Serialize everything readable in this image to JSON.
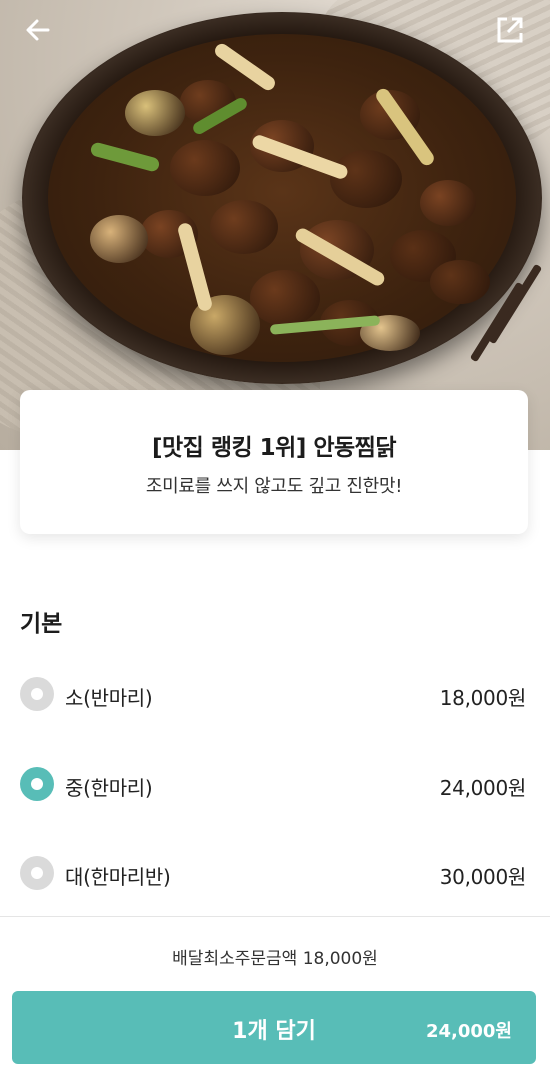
{
  "hero": {
    "image_alt": "안동찜닭 음식 사진",
    "back_icon": "arrow-left-icon",
    "share_icon": "expand-share-icon"
  },
  "product": {
    "title": "[맛집 랭킹 1위] 안동찜닭",
    "subtitle": "조미료를 쓰지 않고도  깊고 진한맛!"
  },
  "options": {
    "section_title": "기본",
    "items": [
      {
        "label": "소(반마리)",
        "price": "18,000원",
        "selected": false
      },
      {
        "label": "중(한마리)",
        "price": "24,000원",
        "selected": true
      },
      {
        "label": "대(한마리반)",
        "price": "30,000원",
        "selected": false
      }
    ]
  },
  "footer": {
    "min_order": "배달최소주문금액 18,000원",
    "cart_label": "1개 담기",
    "cart_price": "24,000원"
  },
  "colors": {
    "accent": "#58bdb7",
    "radio_off": "#dadada"
  }
}
